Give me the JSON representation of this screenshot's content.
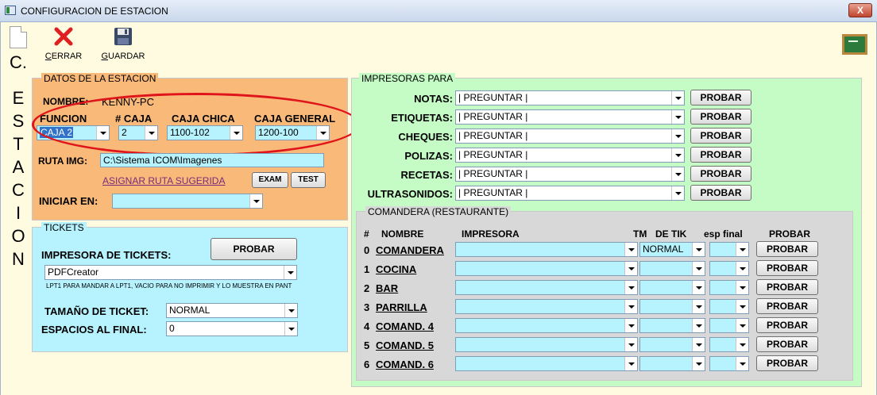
{
  "window": {
    "title": "CONFIGURACION DE ESTACION",
    "close_label": "X"
  },
  "toolbar": {
    "cerrar": "CERRAR",
    "guardar": "GUARDAR"
  },
  "side_vertical": [
    "C.",
    "E",
    "S",
    "T",
    "A",
    "C",
    "I",
    "O",
    "N"
  ],
  "datos": {
    "legend": "DATOS DE LA ESTACION",
    "nombre_label": "NOMBRE:",
    "nombre_value": "KENNY-PC",
    "funcion_label": "FUNCION",
    "funcion_value": "CAJA 2",
    "caja_label": "# CAJA",
    "caja_value": "2",
    "caja_chica_label": "CAJA CHICA",
    "caja_chica_value": "1100-102",
    "caja_general_label": "CAJA GENERAL",
    "caja_general_value": "1200-100",
    "ruta_label": "RUTA IMG:",
    "ruta_value": "C:\\Sistema ICOM\\Imagenes",
    "asignar_link": "ASIGNAR RUTA SUGERIDA",
    "exam_label": "EXAM",
    "test_label": "TEST",
    "iniciar_label": "INICIAR EN:",
    "iniciar_value": ""
  },
  "tickets": {
    "legend": "TICKETS",
    "impresora_label": "IMPRESORA DE TICKETS:",
    "probar_label": "PROBAR",
    "impresora_value": "PDFCreator",
    "hint": "LPT1 PARA MANDAR A LPT1, VACIO PARA NO IMPRIMIR Y LO MUESTRA EN PANT",
    "tamano_label": "TAMAÑO DE TICKET:",
    "tamano_value": "NORMAL",
    "espacios_label": "ESPACIOS AL FINAL:",
    "espacios_value": "0"
  },
  "impresoras": {
    "legend": "IMPRESORAS PARA",
    "rows": [
      {
        "label": "NOTAS:",
        "value": "| PREGUNTAR |",
        "button": "PROBAR"
      },
      {
        "label": "ETIQUETAS:",
        "value": "| PREGUNTAR |",
        "button": "PROBAR"
      },
      {
        "label": "CHEQUES:",
        "value": "| PREGUNTAR |",
        "button": "PROBAR"
      },
      {
        "label": "POLIZAS:",
        "value": "| PREGUNTAR |",
        "button": "PROBAR"
      },
      {
        "label": "RECETAS:",
        "value": "| PREGUNTAR |",
        "button": "PROBAR"
      },
      {
        "label": "ULTRASONIDOS:",
        "value": "| PREGUNTAR |",
        "button": "PROBAR"
      }
    ]
  },
  "comandera": {
    "legend": "COMANDERA (RESTAURANTE)",
    "headers": {
      "num": "#",
      "nombre": "NOMBRE",
      "impresora": "IMPRESORA",
      "tm": "TM",
      "detik": "DE TIK",
      "esp": "esp final",
      "probar": "PROBAR"
    },
    "rows": [
      {
        "num": "0",
        "nombre": "COMANDERA",
        "tm": "NORMAL",
        "button": "PROBAR"
      },
      {
        "num": "1",
        "nombre": "COCINA",
        "tm": "",
        "button": "PROBAR"
      },
      {
        "num": "2",
        "nombre": "BAR",
        "tm": "",
        "button": "PROBAR"
      },
      {
        "num": "3",
        "nombre": "PARRILLA",
        "tm": "",
        "button": "PROBAR"
      },
      {
        "num": "4",
        "nombre": "COMAND. 4",
        "tm": "",
        "button": "PROBAR"
      },
      {
        "num": "5",
        "nombre": "COMAND. 5",
        "tm": "",
        "button": "PROBAR"
      },
      {
        "num": "6",
        "nombre": "COMAND. 6",
        "tm": "",
        "button": "PROBAR"
      }
    ]
  }
}
